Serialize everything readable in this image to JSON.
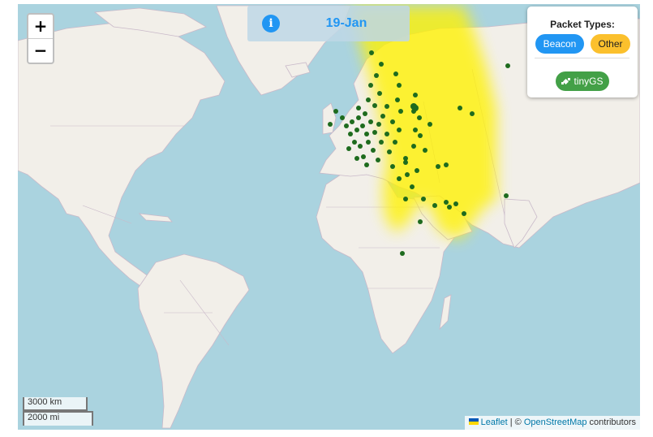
{
  "zoom": {
    "in_label": "+",
    "out_label": "−"
  },
  "header": {
    "date": "19-Jan",
    "info_icon": "i"
  },
  "legend": {
    "title": "Packet Types:",
    "beacon_label": "Beacon",
    "other_label": "Other",
    "tinygs_label": "tinyGS",
    "colors": {
      "beacon": "#2196f3",
      "other": "#fbc02d",
      "tinygs": "#43a047"
    }
  },
  "scale": {
    "km": "3000 km",
    "mi": "2000 mi"
  },
  "attribution": {
    "leaflet": "Leaflet",
    "separator": " | © ",
    "osm": "OpenStreetMap",
    "contributors": " contributors"
  },
  "map": {
    "colors": {
      "water": "#aad3df",
      "land": "#f2efe9",
      "border": "#c9b9c9",
      "coverage": "#fff200",
      "station": "#1e6b1e"
    }
  }
}
